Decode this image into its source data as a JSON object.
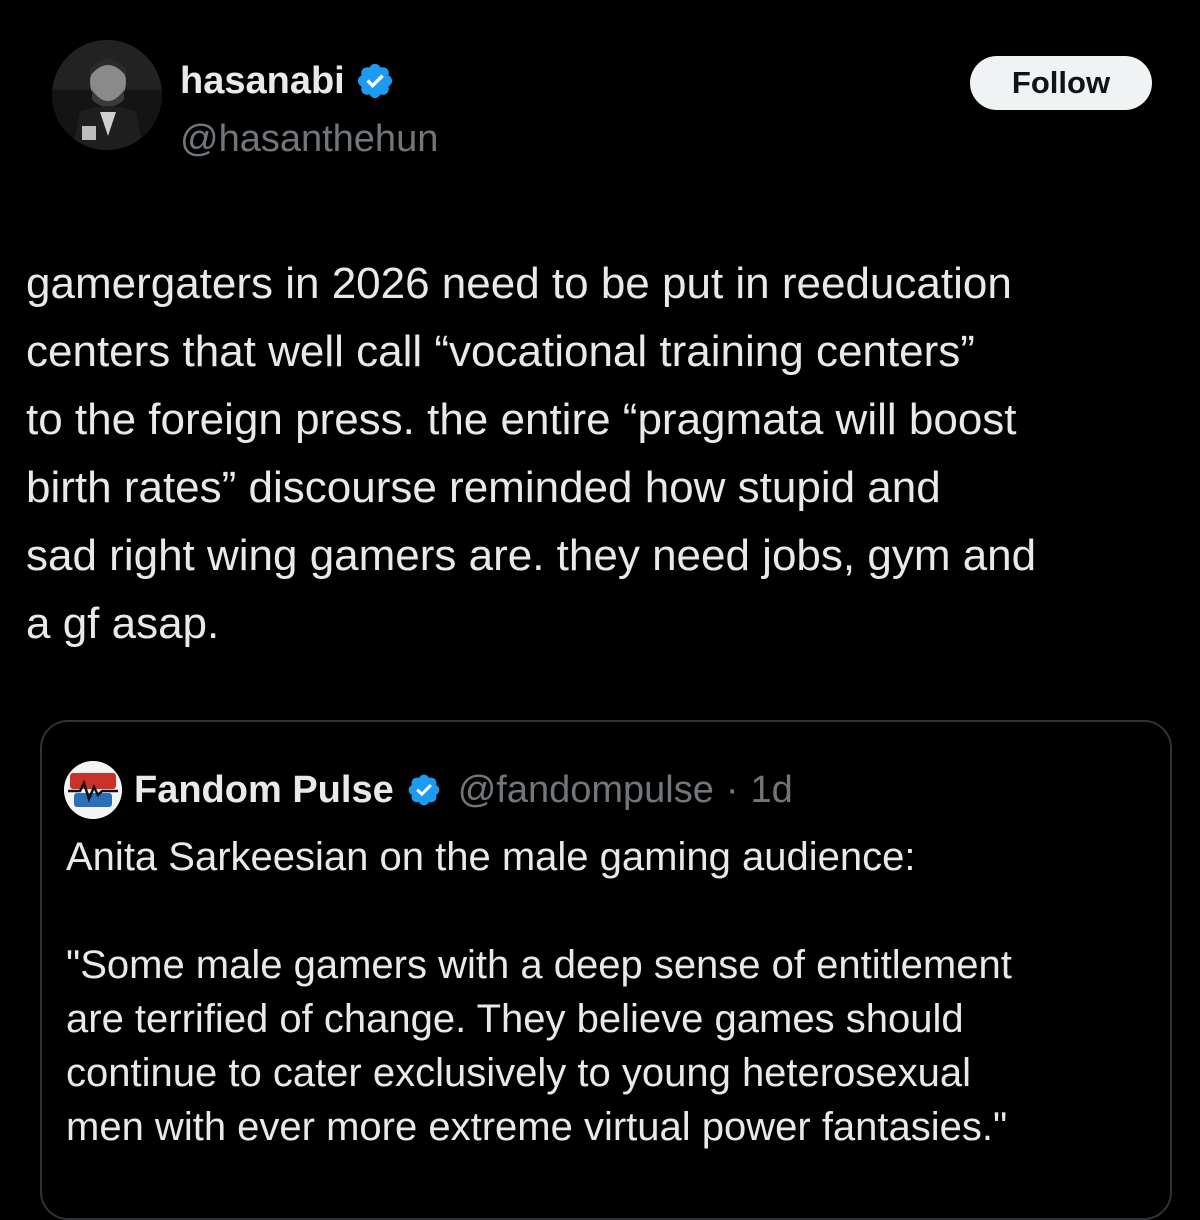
{
  "post": {
    "author": {
      "display_name": "hasanabi",
      "handle": "@hasanthehun",
      "verified_icon": "verified-badge-icon"
    },
    "follow_label": "Follow",
    "text": "gamergaters in 2026 need to be put in reeducation\ncenters that well call “vocational training centers”\nto the foreign press. the entire “pragmata will boost\nbirth rates” discourse reminded how stupid and\nsad right wing gamers are. they need jobs, gym and\na gf asap."
  },
  "quoted_post": {
    "author": {
      "display_name": "Fandom Pulse",
      "handle": "@fandompulse",
      "verified_icon": "verified-badge-icon"
    },
    "separator": "·",
    "timestamp": "1d",
    "text": "Anita Sarkeesian on the male gaming audience:\n\n\"Some male gamers with a deep sense of entitlement\nare terrified of change. They believe games should\ncontinue to cater exclusively to young heterosexual\nmen with ever more extreme virtual power fantasies.\""
  },
  "colors": {
    "background": "#000000",
    "text_primary": "#e7e9ea",
    "text_secondary": "#71767b",
    "verified_blue": "#1d9bf0",
    "follow_button_bg": "#eff3f4",
    "card_border": "#2f3336"
  }
}
